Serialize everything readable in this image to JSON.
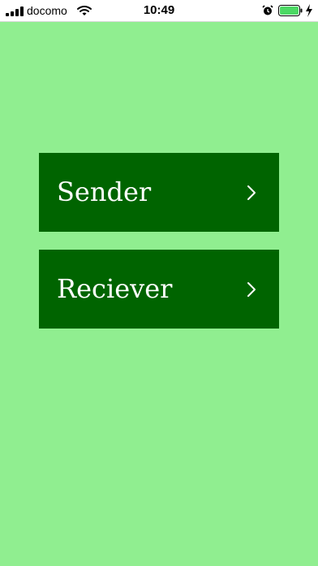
{
  "status_bar": {
    "carrier": "docomo",
    "time": "10:49",
    "signal_icon": "cellular-signal-icon",
    "wifi_icon": "wifi-icon",
    "alarm_icon": "alarm-clock-icon",
    "battery_icon": "battery-icon",
    "charging_icon": "charging-bolt-icon"
  },
  "menu": {
    "items": [
      {
        "label": "Sender",
        "icon": "chevron-right-icon"
      },
      {
        "label": "Reciever",
        "icon": "chevron-right-icon"
      }
    ]
  },
  "colors": {
    "background": "#90ee90",
    "button": "#006400",
    "button_text": "#ffffff",
    "battery_fill": "#4cd964"
  }
}
